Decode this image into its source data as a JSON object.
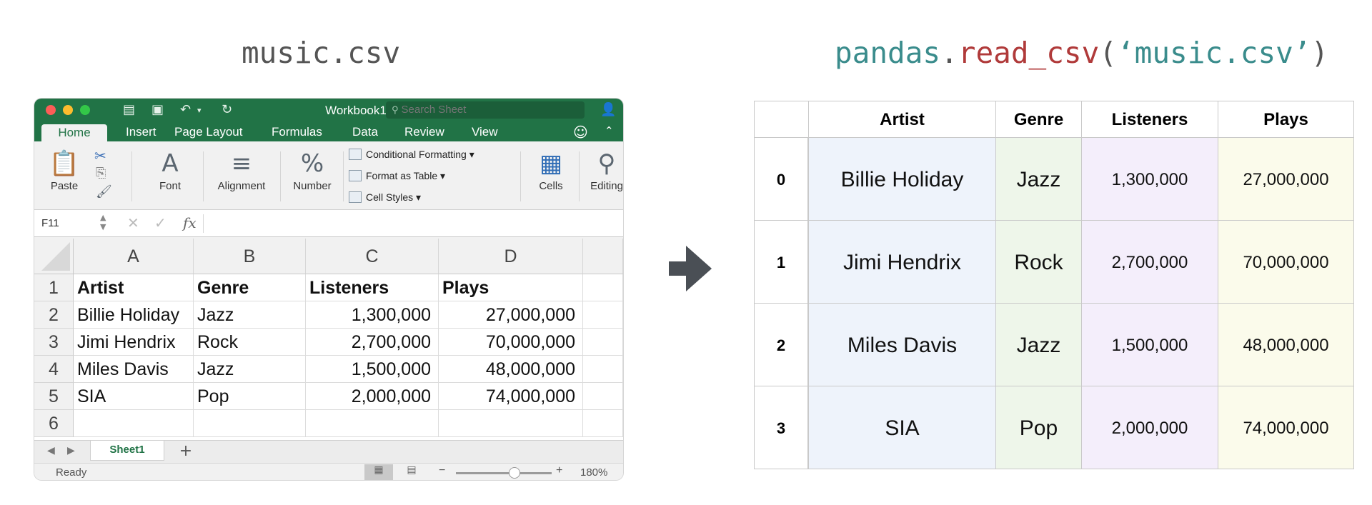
{
  "captions": {
    "left": "music.csv",
    "right": {
      "module": "pandas",
      "dot": ".",
      "func": "read_csv",
      "open": "(",
      "arg": "‘music.csv’",
      "close": ")"
    }
  },
  "excel": {
    "window_title": "Workbook1",
    "search_placeholder": "Search Sheet",
    "ribbon_tabs": [
      "Home",
      "Insert",
      "Page Layout",
      "Formulas",
      "Data",
      "Review",
      "View"
    ],
    "active_tab": "Home",
    "ribbon_groups": {
      "paste": "Paste",
      "font": "Font",
      "alignment": "Alignment",
      "number": "Number",
      "conditional_formatting": "Conditional Formatting",
      "format_as_table": "Format as Table",
      "cell_styles": "Cell Styles",
      "cells": "Cells",
      "editing": "Editing"
    },
    "formula_bar": {
      "cell_ref": "F11",
      "fx": "fx",
      "value": ""
    },
    "columns": [
      "A",
      "B",
      "C",
      "D"
    ],
    "rows": [
      {
        "num": "1",
        "cells": [
          "Artist",
          "Genre",
          "Listeners",
          "Plays"
        ]
      },
      {
        "num": "2",
        "cells": [
          "Billie Holiday",
          "Jazz",
          "1,300,000",
          "27,000,000"
        ]
      },
      {
        "num": "3",
        "cells": [
          "Jimi Hendrix",
          "Rock",
          "2,700,000",
          "70,000,000"
        ]
      },
      {
        "num": "4",
        "cells": [
          "Miles Davis",
          "Jazz",
          "1,500,000",
          "48,000,000"
        ]
      },
      {
        "num": "5",
        "cells": [
          "SIA",
          "Pop",
          "2,000,000",
          "74,000,000"
        ]
      },
      {
        "num": "6",
        "cells": [
          "",
          "",
          "",
          ""
        ]
      }
    ],
    "sheet_tab": "Sheet1",
    "add_sheet": "+",
    "status": "Ready",
    "zoom": "180%"
  },
  "dataframe": {
    "columns": [
      "Artist",
      "Genre",
      "Listeners",
      "Plays"
    ],
    "index": [
      "0",
      "1",
      "2",
      "3"
    ],
    "rows": [
      [
        "Billie Holiday",
        "Jazz",
        "1,300,000",
        "27,000,000"
      ],
      [
        "Jimi Hendrix",
        "Rock",
        "2,700,000",
        "70,000,000"
      ],
      [
        "Miles Davis",
        "Jazz",
        "1,500,000",
        "48,000,000"
      ],
      [
        "SIA",
        "Pop",
        "2,000,000",
        "74,000,000"
      ]
    ],
    "column_colors": [
      "#eef3fb",
      "#eef6ea",
      "#f4eefb",
      "#fbfbeb"
    ]
  },
  "colors": {
    "excel_green": "#217346",
    "caption_teal": "#3a8c8c",
    "caption_red": "#b03a3a",
    "arrow": "#4a4f55"
  }
}
